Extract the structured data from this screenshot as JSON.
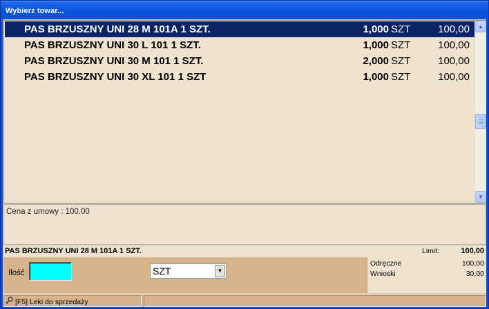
{
  "window": {
    "title": "Wybierz towar..."
  },
  "products": [
    {
      "name": "PAS BRZUSZNY UNI 28 M  101A 1 SZT.",
      "qty": "1,000",
      "unit": "SZT",
      "price": "100,00",
      "selected": true
    },
    {
      "name": "PAS BRZUSZNY UNI 30  L 101 1 SZT.",
      "qty": "1,000",
      "unit": "SZT",
      "price": "100,00",
      "selected": false
    },
    {
      "name": "PAS BRZUSZNY UNI 30 M  101 1 SZT.",
      "qty": "2,000",
      "unit": "SZT",
      "price": "100,00",
      "selected": false
    },
    {
      "name": "PAS BRZUSZNY UNI 30 XL 101 1 SZT",
      "qty": "1,000",
      "unit": "SZT",
      "price": "100,00",
      "selected": false
    }
  ],
  "info": {
    "text": "Cena z umowy : 100.00"
  },
  "selected_product": {
    "name": "PAS BRZUSZNY UNI 28 M  101A 1 SZT.",
    "limit_label": "Limit:",
    "limit_value": "100,00"
  },
  "form": {
    "qty_label": "Ilość",
    "qty_value": "",
    "unit_selected": "SZT"
  },
  "side_panel": {
    "odreczne_label": "Odręczne",
    "odreczne_value": "100,00",
    "wnioski_label": "Wnioski",
    "wnioski_value": "30,00"
  },
  "status": {
    "text": "[F5] Leki do sprzedaży"
  },
  "colors": {
    "selection": "#0a2465",
    "list_bg": "#efe3d0",
    "panel_bg": "#d6b38a",
    "qty_input_bg": "#00ffff",
    "titlebar": "#0a55df"
  }
}
